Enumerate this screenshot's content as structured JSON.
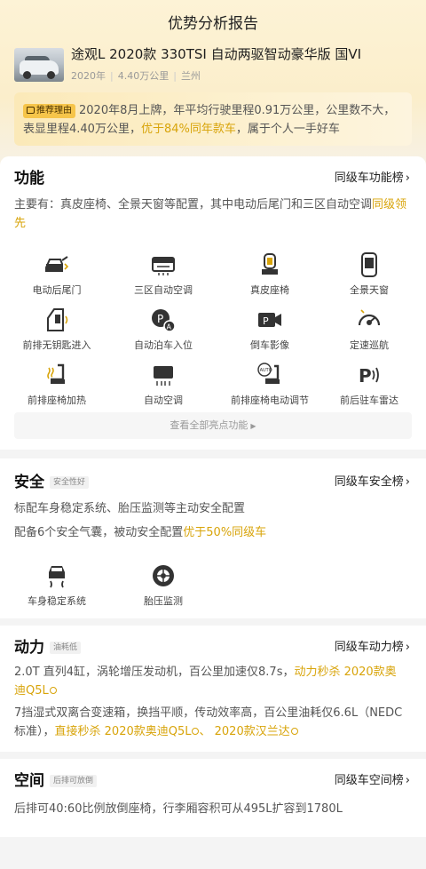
{
  "header": {
    "title": "优势分析报告"
  },
  "car": {
    "name": "途观L 2020款 330TSI 自动两驱智动豪华版 国VI",
    "year": "2020年",
    "mileage": "4.40万公里",
    "city": "兰州"
  },
  "reason": {
    "tag": "推荐理由",
    "text_1": "2020年8月上牌，年平均行驶里程0.91万公里，公里数不大，表显里程4.40万公里，",
    "highlight": "优于84%同年款车",
    "text_2": "，属于个人一手好车"
  },
  "function": {
    "title": "功能",
    "rank_link": "同级车功能榜",
    "summary": "主要有：真皮座椅、全景天窗等配置，其中电动后尾门和三区自动空调",
    "summary_highlight": "同级领先",
    "features": [
      {
        "label": "电动后尾门",
        "icon": "tailgate-icon"
      },
      {
        "label": "三区自动空调",
        "icon": "climate-zone-icon"
      },
      {
        "label": "真皮座椅",
        "icon": "leather-seat-icon"
      },
      {
        "label": "全景天窗",
        "icon": "sunroof-icon"
      },
      {
        "label": "前排无钥匙进入",
        "icon": "keyless-entry-icon"
      },
      {
        "label": "自动泊车入位",
        "icon": "auto-parking-icon"
      },
      {
        "label": "倒车影像",
        "icon": "reverse-camera-icon"
      },
      {
        "label": "定速巡航",
        "icon": "cruise-control-icon"
      },
      {
        "label": "前排座椅加热",
        "icon": "seat-heating-icon"
      },
      {
        "label": "自动空调",
        "icon": "auto-ac-icon"
      },
      {
        "label": "前排座椅电动调节",
        "icon": "power-seat-icon"
      },
      {
        "label": "前后驻车雷达",
        "icon": "parking-radar-icon"
      }
    ],
    "more": "查看全部亮点功能"
  },
  "safety": {
    "title": "安全",
    "tag": "安全性好",
    "rank_link": "同级车安全榜",
    "line_1": "标配车身稳定系统、胎压监测等主动安全配置",
    "line_2": "配备6个安全气囊，被动安全配置",
    "line_2_highlight": "优于50%同级车",
    "features": [
      {
        "label": "车身稳定系统",
        "icon": "stability-control-icon"
      },
      {
        "label": "胎压监测",
        "icon": "tire-pressure-icon"
      }
    ]
  },
  "power": {
    "title": "动力",
    "tag": "油耗低",
    "rank_link": "同级车动力榜",
    "line_1": "2.0T 直列4缸，涡轮增压发动机，百公里加速仅8.7s，",
    "line_1_highlight_a": "动力秒杀 2020款奥",
    "line_1_highlight_b": "迪Q5L",
    "line_2": "7挡湿式双离合变速箱，换挡平顺，传动效率高，百公里油耗仅6.6L（NEDC标准），",
    "line_2_highlight_a": "直接秒杀 2020款奥迪Q5L",
    "line_2_sep": "、",
    "line_2_highlight_b": "2020款汉兰达"
  },
  "space": {
    "title": "空间",
    "tag": "后排可放倒",
    "rank_link": "同级车空间榜",
    "line_1": "后排可40:60比例放倒座椅，行李厢容积可从495L扩容到1780L"
  },
  "colors": {
    "accent": "#d8a40a",
    "tag_bg": "#f6c54a",
    "top_bg": "#fdf3d6"
  }
}
